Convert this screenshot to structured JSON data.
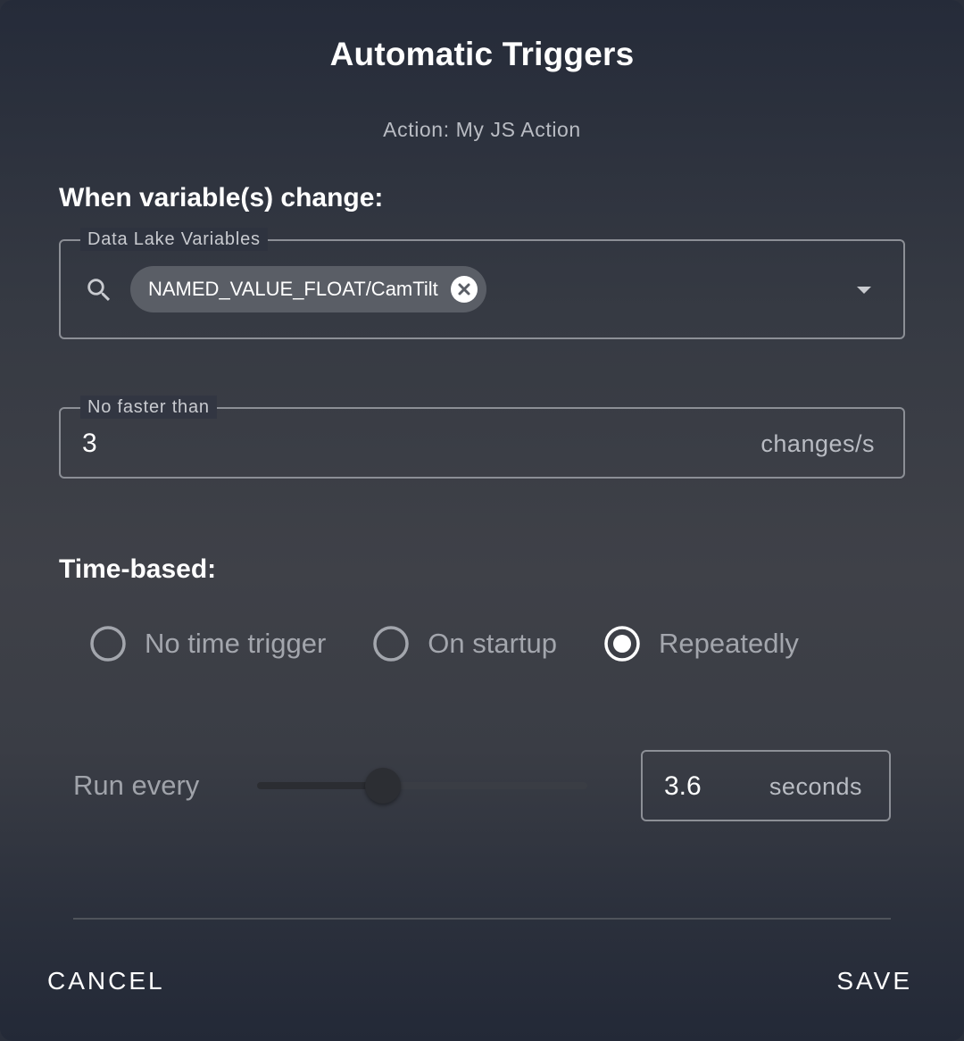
{
  "dialog": {
    "title": "Automatic Triggers",
    "subtitle": "Action: My JS Action"
  },
  "variables_section": {
    "heading": "When variable(s) change:",
    "field_label": "Data Lake Variables",
    "selected_chip": "NAMED_VALUE_FLOAT/CamTilt",
    "icons": [
      "search-icon",
      "close-circle-icon",
      "dropdown-arrow-icon"
    ]
  },
  "rate_field": {
    "label": "No faster than",
    "value": "3",
    "unit": "changes/s"
  },
  "time_section": {
    "heading": "Time-based:",
    "options": [
      {
        "label": "No time trigger",
        "selected": false
      },
      {
        "label": "On startup",
        "selected": false
      },
      {
        "label": "Repeatedly",
        "selected": true
      }
    ],
    "run_every_label": "Run every",
    "slider_fraction": 0.38,
    "interval_value": "3.6",
    "interval_unit": "seconds"
  },
  "actions": {
    "cancel_label": "CANCEL",
    "save_label": "SAVE"
  },
  "colors": {
    "accent": "#ffffff",
    "muted_text": "#a3a6ad",
    "border": "#8c8f96"
  }
}
